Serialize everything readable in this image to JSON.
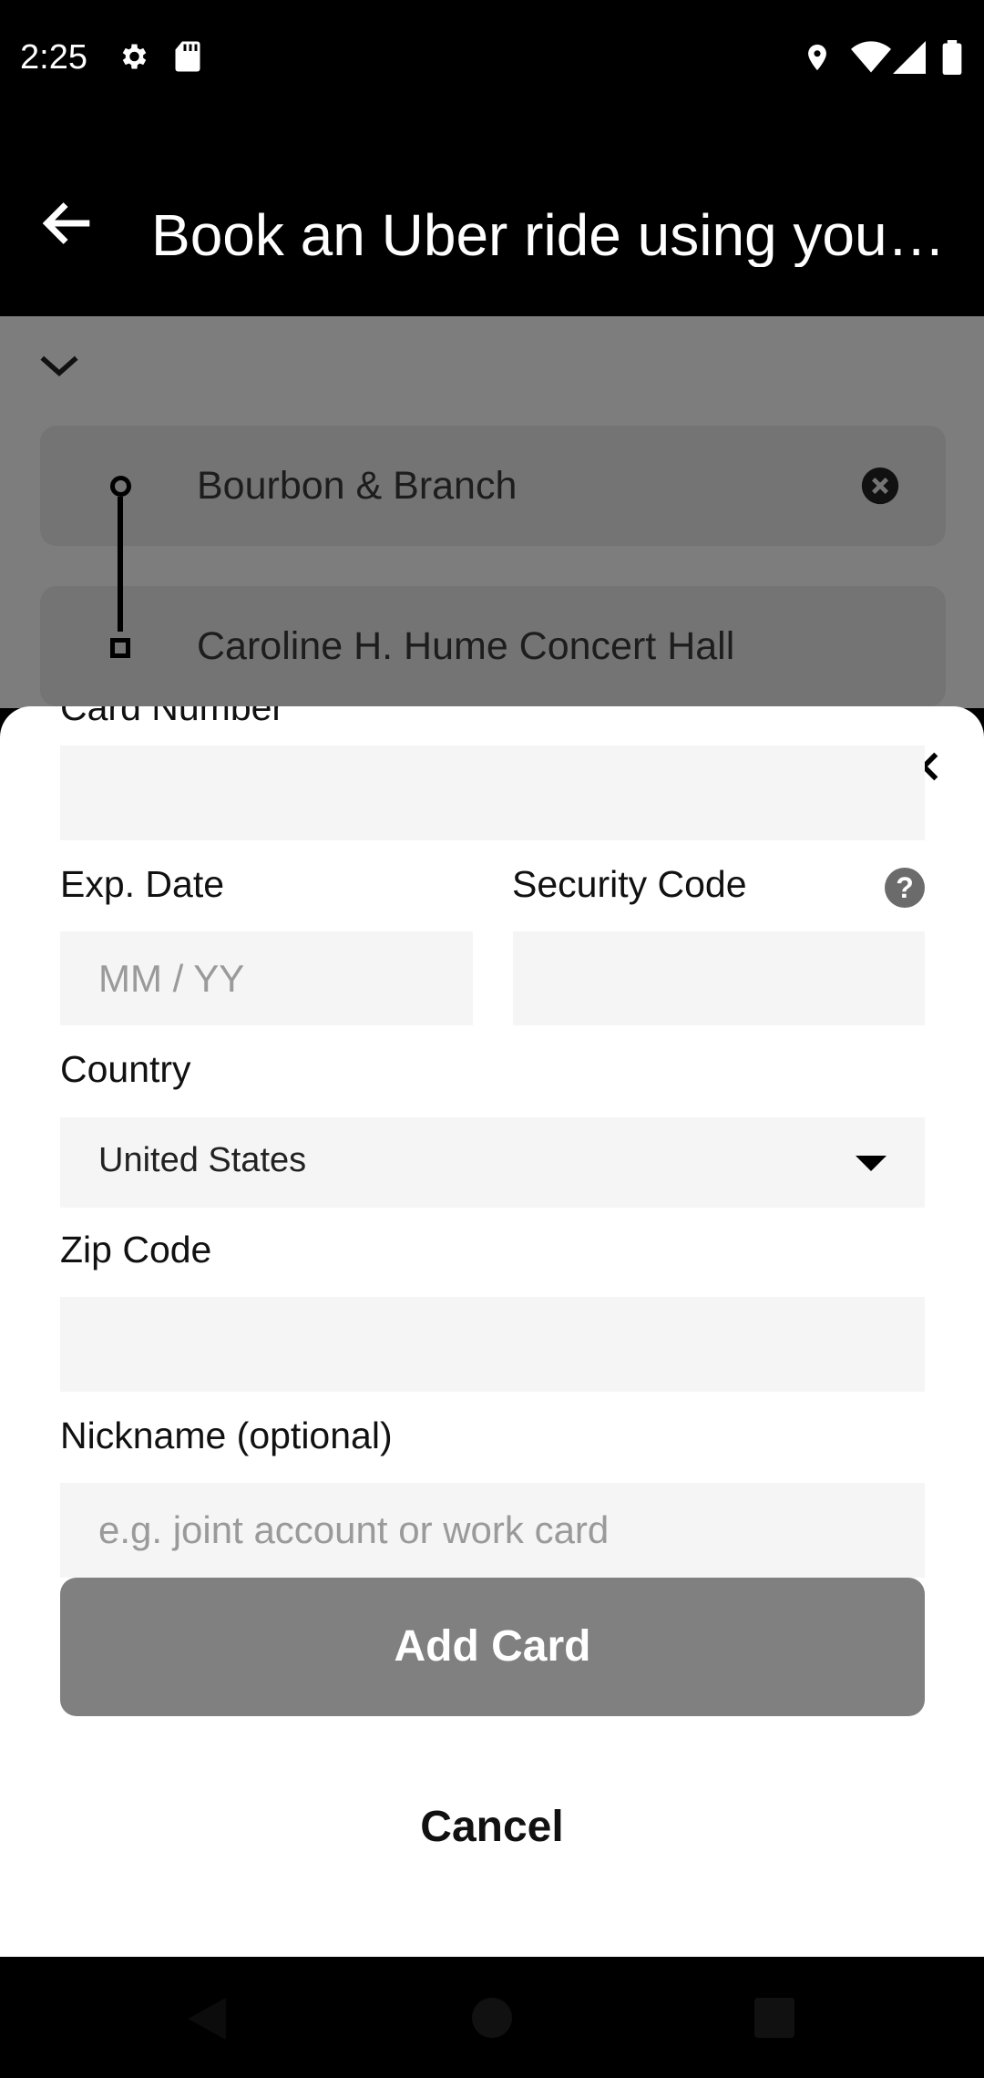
{
  "status_bar": {
    "time": "2:25",
    "icons": [
      "settings-icon",
      "sd-card-icon",
      "location-icon",
      "wifi-icon",
      "signal-icon",
      "battery-icon"
    ]
  },
  "app_bar": {
    "title": "Book an Uber ride using your…",
    "back_icon": "arrow-left-icon"
  },
  "route": {
    "pickup": "Bourbon & Branch",
    "destination": "Caroline H. Hume Concert Hall"
  },
  "card_form": {
    "card_number_label": "Card Number",
    "exp_label": "Exp. Date",
    "exp_placeholder": "MM / YY",
    "security_label": "Security Code",
    "help_glyph": "?",
    "country_label": "Country",
    "country_value": "United States",
    "zip_label": "Zip Code",
    "nickname_label": "Nickname (optional)",
    "nickname_placeholder": "e.g. joint account or work card",
    "add_button": "Add Card",
    "cancel_button": "Cancel"
  },
  "colors": {
    "add_button_bg": "#808080",
    "field_bg": "#f5f5f5",
    "overlay_bg": "#7d7d7d"
  }
}
